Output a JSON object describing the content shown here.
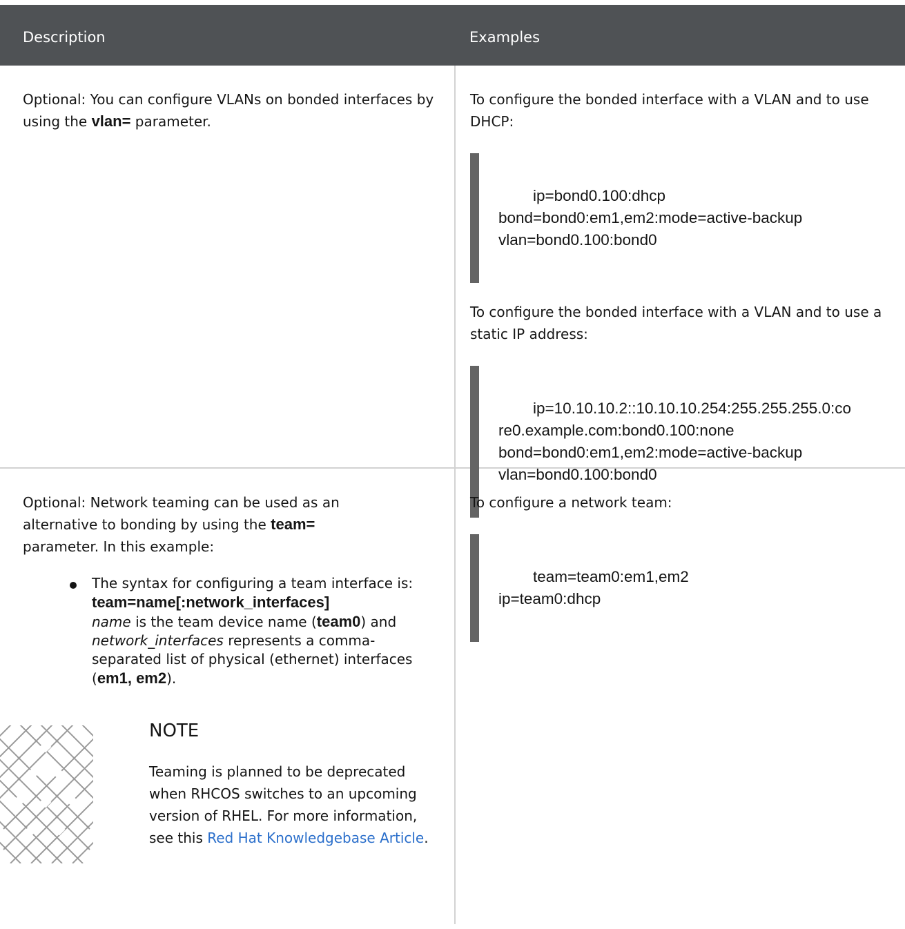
{
  "header": {
    "description": "Description",
    "examples": "Examples"
  },
  "row1": {
    "desc_prefix": "Optional: You can configure VLANs on bonded interfaces by using the ",
    "desc_code": "vlan=",
    "desc_suffix": " parameter.",
    "ex1_text": "To configure the bonded interface with a VLAN and to use DHCP:",
    "ex1_code": "ip=bond0.100:dhcp\nbond=bond0:em1,em2:mode=active-backup\nvlan=bond0.100:bond0",
    "ex2_text": "To configure the bonded interface with a VLAN and to use a static IP address:",
    "ex2_code": "ip=10.10.10.2::10.10.10.254:255.255.255.0:co\nre0.example.com:bond0.100:none\nbond=bond0:em1,em2:mode=active-backup\nvlan=bond0.100:bond0"
  },
  "row2": {
    "desc_prefix": "Optional: Network teaming can be used as an alternative to bonding by using the ",
    "desc_code": "team=",
    "desc_suffix": "parameter. In this example:",
    "bullet": {
      "t1": "The syntax for configuring a team interface is: ",
      "c1": "team=name[:network_interfaces]",
      "i1": "name",
      "t2": " is the team device name (",
      "c2": "team0",
      "t3": ") and ",
      "i2": "network_interfaces",
      "t4": " represents a comma-separated list of physical (ethernet) interfaces (",
      "c3": "em1, em2",
      "t5": ")."
    },
    "note": {
      "title": "NOTE",
      "body": "Teaming is planned to be deprecated when RHCOS switches to an upcoming version of RHEL. For more information, see this ",
      "link": "Red Hat Knowledgebase Article",
      "end": "."
    },
    "ex_text": "To configure a network team:",
    "ex_code": "team=team0:em1,em2\nip=team0:dhcp"
  },
  "colors": {
    "header_bg": "#4f5255",
    "code_bar": "#646464",
    "link": "#2b6fcb",
    "border": "#d2d2d2"
  }
}
